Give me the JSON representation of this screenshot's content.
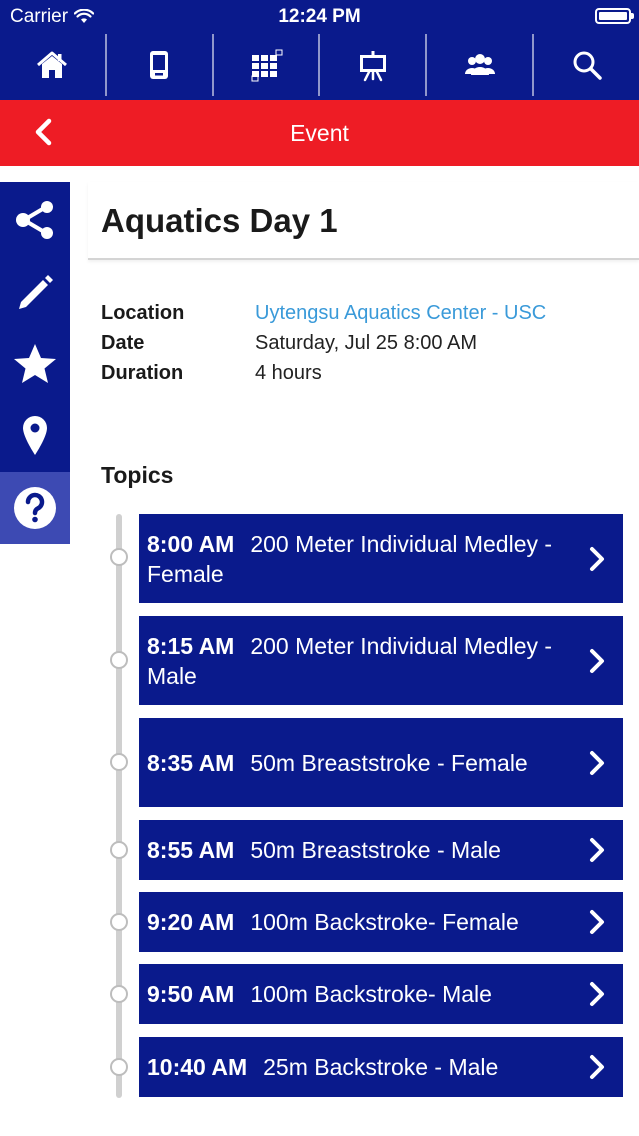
{
  "status_bar": {
    "carrier": "Carrier",
    "time": "12:24 PM"
  },
  "nav_bar": {
    "items": [
      {
        "icon": "home-icon"
      },
      {
        "icon": "device-icon"
      },
      {
        "icon": "grid-icon"
      },
      {
        "icon": "presentation-board-icon"
      },
      {
        "icon": "people-icon"
      },
      {
        "icon": "search-icon"
      }
    ]
  },
  "title_bar": {
    "title": "Event"
  },
  "side_rail": {
    "items": [
      "share-icon",
      "pencil-icon",
      "star-icon",
      "map-pin-icon",
      "help-icon"
    ]
  },
  "event": {
    "title": "Aquatics Day 1",
    "location_label": "Location",
    "location_value": "Uytengsu Aquatics Center - USC",
    "date_label": "Date",
    "date_value": "Saturday, Jul 25 8:00 AM",
    "duration_label": "Duration",
    "duration_value": "4 hours"
  },
  "topics": {
    "heading": "Topics",
    "items": [
      {
        "time": "8:00 AM",
        "title": "200 Meter Individual Medley - Female"
      },
      {
        "time": "8:15 AM",
        "title": "200 Meter Individual Medley - Male"
      },
      {
        "time": "8:35 AM",
        "title": "50m Breaststroke - Female"
      },
      {
        "time": "8:55 AM",
        "title": "50m Breaststroke - Male"
      },
      {
        "time": "9:20 AM",
        "title": "100m Backstroke- Female"
      },
      {
        "time": "9:50 AM",
        "title": "100m Backstroke- Male"
      },
      {
        "time": "10:40 AM",
        "title": "25m Backstroke - Male"
      }
    ]
  },
  "colors": {
    "primary": "#0a1a8c",
    "accent": "#ee1c25",
    "link": "#3a9ad9",
    "rail_active": "#3d4ab3"
  }
}
